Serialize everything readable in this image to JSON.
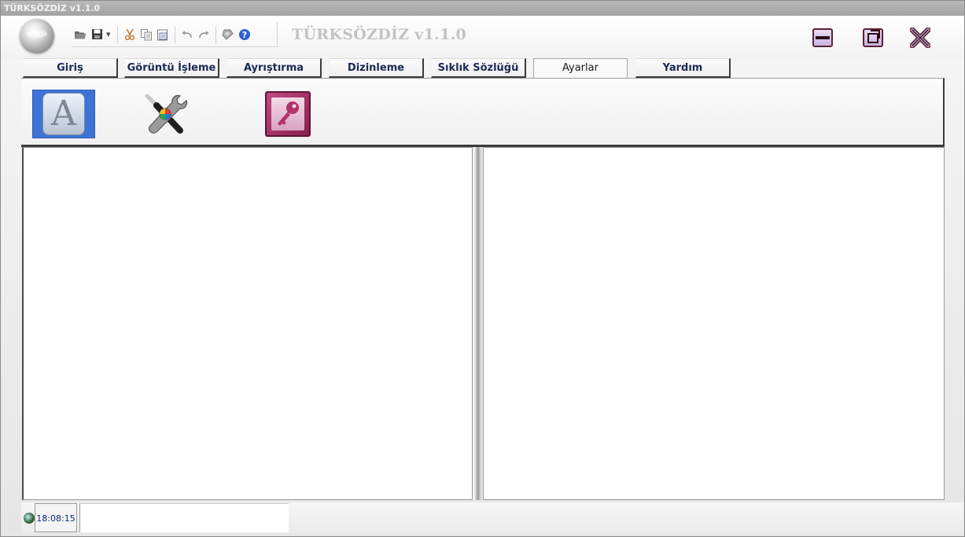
{
  "window": {
    "title": "TÜRKSÖZDİZ v1.1.0"
  },
  "header": {
    "app_title": "TÜRKSÖZDİZ v1.1.0",
    "quick_access": [
      "open-folder-icon",
      "save-icon",
      "cut-icon",
      "copy-icon",
      "paste-icon",
      "undo-icon",
      "redo-icon",
      "print-icon",
      "help-icon"
    ]
  },
  "tabs": [
    {
      "label": "Giriş",
      "active": false
    },
    {
      "label": "Görüntü İşleme",
      "active": false
    },
    {
      "label": "Ayrıştırma",
      "active": false
    },
    {
      "label": "Dizinleme",
      "active": false
    },
    {
      "label": "Sıklık Sözlüğü",
      "active": false
    },
    {
      "label": "Ayarlar",
      "active": true
    },
    {
      "label": "Yardım",
      "active": false
    }
  ],
  "ribbon": {
    "buttons": [
      "font-settings-icon",
      "tools-icon",
      "access-database-icon"
    ]
  },
  "status": {
    "time": "18:08:15",
    "message": ""
  }
}
